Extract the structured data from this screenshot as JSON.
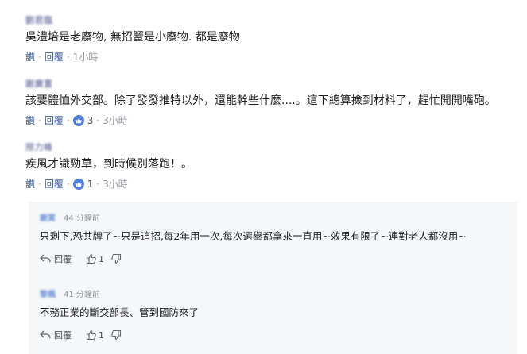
{
  "comments": [
    {
      "author": "劉君臨",
      "text": "吳澧培是老廢物, 無招蟹是小廢物. 都是廢物",
      "reply_label": "讚",
      "reply2_label": "回覆",
      "time": "1小時"
    },
    {
      "author": "謝廣富",
      "text": "該要體恤外交部。除了發發推特以外，還能幹些什麼....。這下總算撿到材料了，趕忙開開嘴砲。",
      "reply_label": "讚",
      "reply2_label": "回覆",
      "likes": "3",
      "time": "3小時"
    },
    {
      "author": "邢力峰",
      "text": "疾風才識勁草，到時候別落跑！。",
      "reply_label": "讚",
      "reply2_label": "回覆",
      "likes": "1",
      "time": "3小時"
    }
  ],
  "replies": [
    {
      "author": "謝寅",
      "time": "44 分鐘前",
      "text": "只剩下,恐共牌了~只是這招,每2年用一次,每次選舉都拿來一直用~效果有限了~連對老人都沒用~",
      "reply_label": "回覆",
      "likes": "1"
    },
    {
      "author": "黎楓",
      "time": "41 分鐘前",
      "text": "不務正業的斷交部長、管到國防來了",
      "reply_label": "回覆",
      "likes": "1"
    }
  ],
  "colors": {
    "link": "#385898",
    "like_badge": "#4f7dd9",
    "reply_bg": "#f6f7f9"
  }
}
